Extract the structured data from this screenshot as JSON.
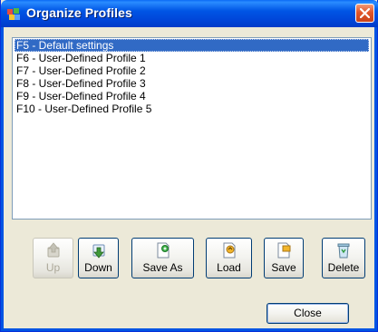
{
  "window": {
    "title": "Organize Profiles"
  },
  "profiles": [
    "F5 - Default settings",
    "F6 - User-Defined Profile 1",
    "F7 - User-Defined Profile 2",
    "F8 - User-Defined Profile 3",
    "F9 - User-Defined Profile 4",
    "F10 - User-Defined Profile 5"
  ],
  "selected_index": 0,
  "buttons": {
    "up": "Up",
    "down": "Down",
    "save_as": "Save As",
    "load": "Load",
    "save": "Save",
    "delete": "Delete",
    "close": "Close"
  },
  "colors": {
    "titlebar": "#0055e5",
    "selection": "#316ac5",
    "dialog": "#ece9d8"
  }
}
